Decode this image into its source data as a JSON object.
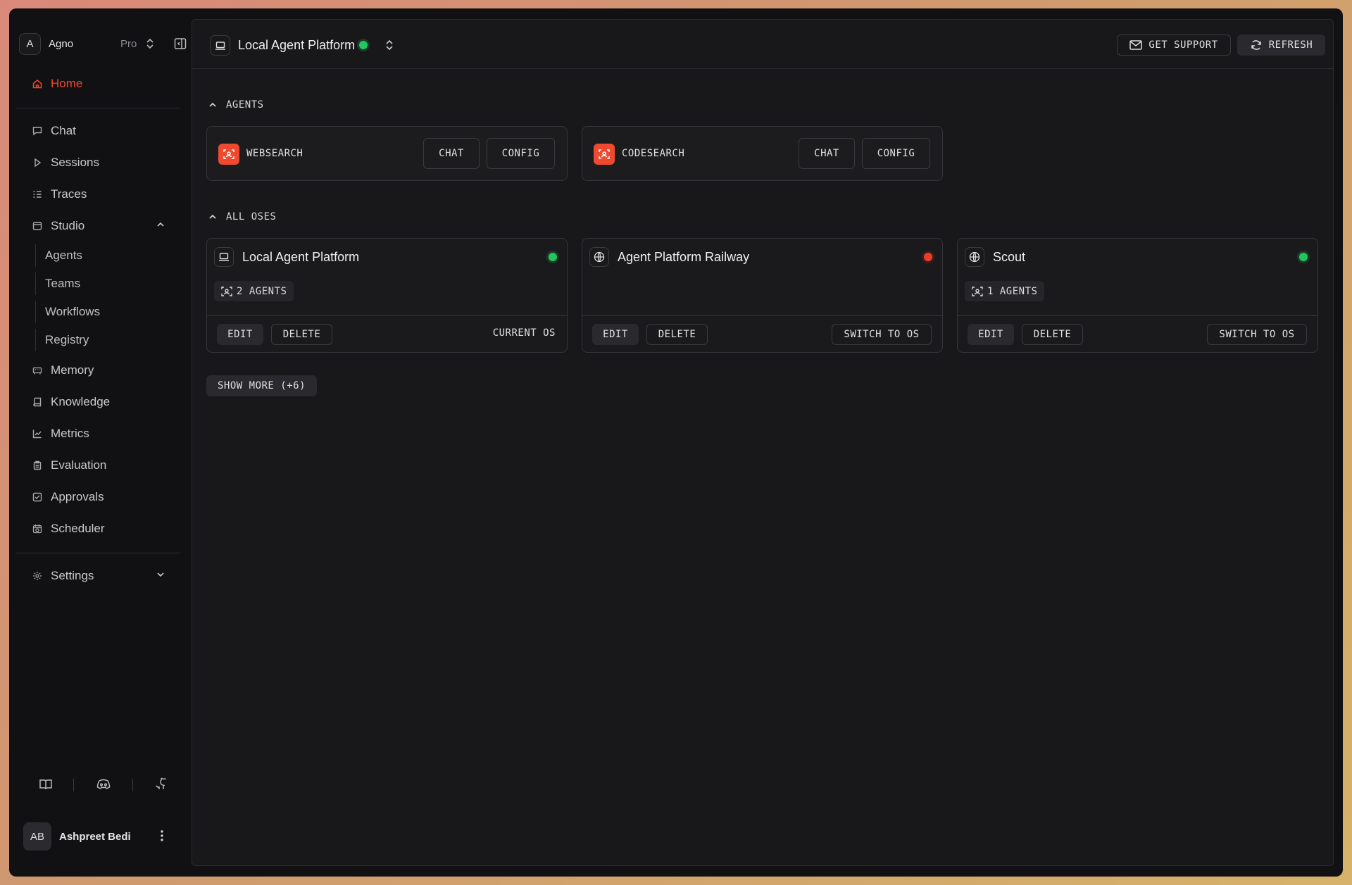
{
  "org": {
    "initial": "A",
    "name": "Agno",
    "plan": "Pro"
  },
  "sidebar": {
    "home": "Home",
    "items": [
      {
        "label": "Chat"
      },
      {
        "label": "Sessions"
      },
      {
        "label": "Traces"
      },
      {
        "label": "Studio"
      }
    ],
    "studio_items": [
      {
        "label": "Agents"
      },
      {
        "label": "Teams"
      },
      {
        "label": "Workflows"
      },
      {
        "label": "Registry"
      }
    ],
    "items2": [
      {
        "label": "Memory"
      },
      {
        "label": "Knowledge"
      },
      {
        "label": "Metrics"
      },
      {
        "label": "Evaluation"
      },
      {
        "label": "Approvals"
      },
      {
        "label": "Scheduler"
      }
    ],
    "settings": "Settings"
  },
  "user": {
    "initials": "AB",
    "name": "Ashpreet Bedi"
  },
  "topbar": {
    "title": "Local Agent Platform",
    "support": "GET SUPPORT",
    "refresh": "REFRESH",
    "status_color": "#22c55e"
  },
  "agents_section": {
    "title": "AGENTS",
    "agents": [
      {
        "name": "WEBSEARCH",
        "chat": "CHAT",
        "config": "CONFIG"
      },
      {
        "name": "CODESEARCH",
        "chat": "CHAT",
        "config": "CONFIG"
      }
    ]
  },
  "oses_section": {
    "title": "ALL OSES",
    "oses": [
      {
        "name": "Local Agent Platform",
        "status": "online",
        "agents_badge": "2 AGENTS",
        "edit": "EDIT",
        "delete": "DELETE",
        "action": "CURRENT OS"
      },
      {
        "name": "Agent Platform Railway",
        "status": "offline",
        "edit": "EDIT",
        "delete": "DELETE",
        "action": "SWITCH TO OS"
      },
      {
        "name": "Scout",
        "status": "online",
        "agents_badge": "1 AGENTS",
        "edit": "EDIT",
        "delete": "DELETE",
        "action": "SWITCH TO OS"
      }
    ],
    "show_more": "SHOW MORE (+6)"
  },
  "colors": {
    "accent": "#ef4a2f",
    "online": "#22c55e",
    "offline": "#ef3b2b"
  }
}
